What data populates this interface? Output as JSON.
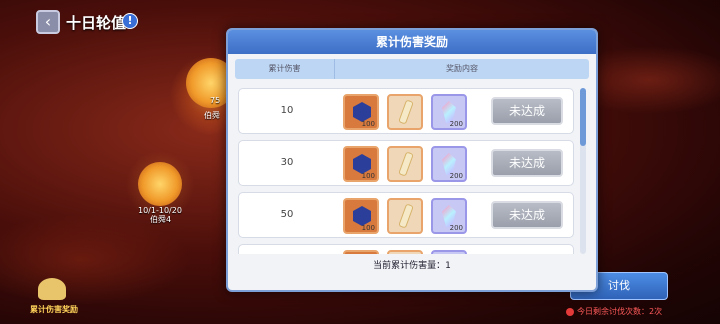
{
  "header": {
    "title": "十日轮值",
    "info_icon": "info-icon",
    "back_icon": "chevron-left-icon"
  },
  "map": {
    "node1_label": "伯舜",
    "node1_badge": "75",
    "node2_date": "10/1-10/20",
    "node2_label": "伯舜4"
  },
  "modal": {
    "title": "累计伤害奖励",
    "col_damage": "累计伤害",
    "col_rewards": "奖励内容",
    "rows": [
      {
        "damage": "10",
        "items": [
          {
            "icon": "blue-gem-icon",
            "count": "100"
          },
          {
            "icon": "candle-icon",
            "count": ""
          },
          {
            "icon": "crystal-icon",
            "count": "200"
          }
        ],
        "status": "未达成"
      },
      {
        "damage": "30",
        "items": [
          {
            "icon": "blue-gem-icon",
            "count": "100"
          },
          {
            "icon": "candle-icon",
            "count": ""
          },
          {
            "icon": "crystal-icon",
            "count": "200"
          }
        ],
        "status": "未达成"
      },
      {
        "damage": "50",
        "items": [
          {
            "icon": "blue-gem-icon",
            "count": "100"
          },
          {
            "icon": "candle-icon",
            "count": ""
          },
          {
            "icon": "crystal-icon",
            "count": "200"
          }
        ],
        "status": "未达成"
      }
    ],
    "footer": "当前累计伤害量：1"
  },
  "bottom_left_label": "累计伤害奖励",
  "attack_button": "讨伐",
  "bottom_status": "今日剩余讨伐次数：2次",
  "colors": {
    "accent": "#3d6fc6",
    "disabled": "#9a9fab",
    "alert": "#ff5a5a"
  }
}
